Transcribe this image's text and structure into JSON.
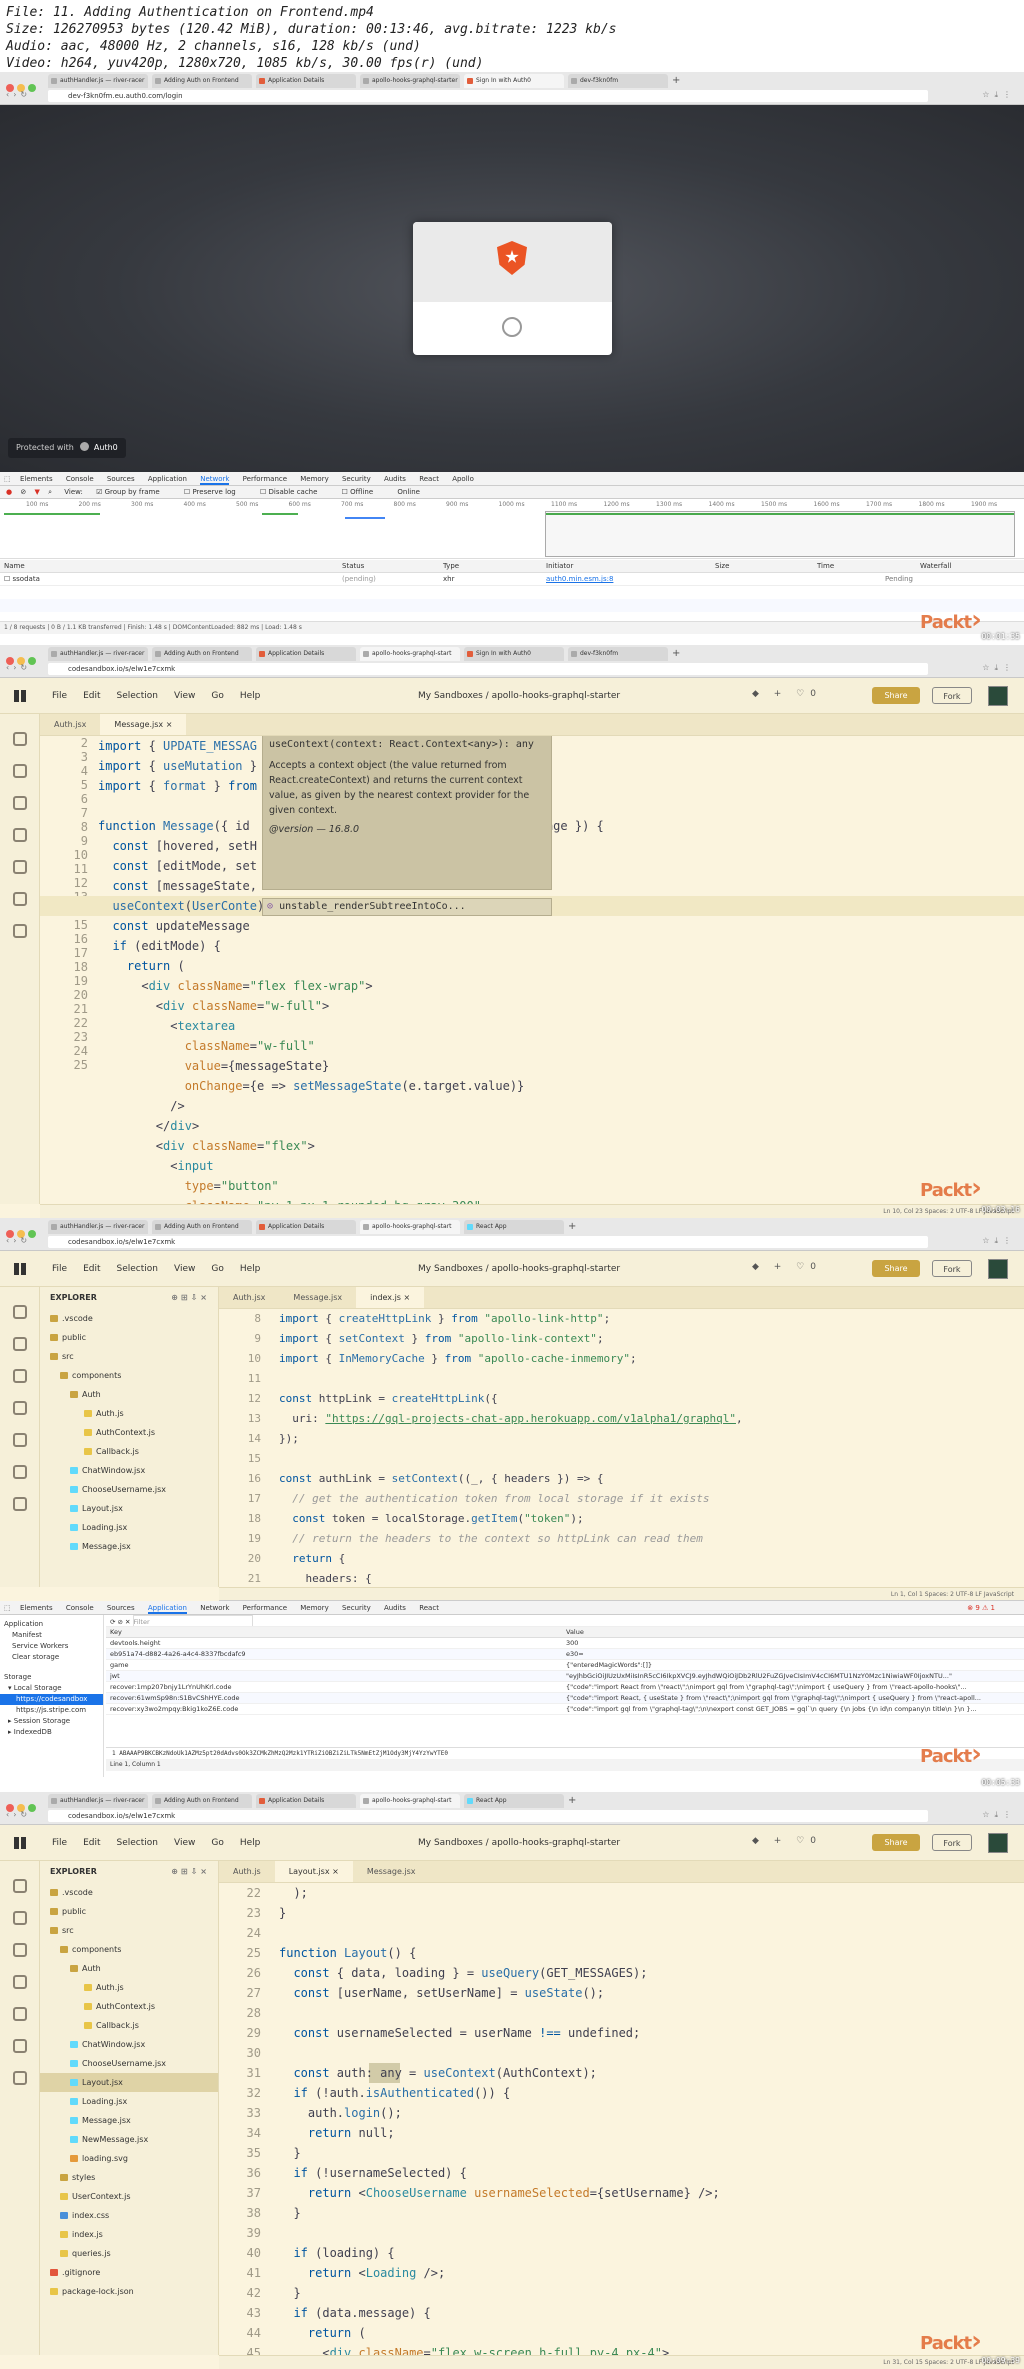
{
  "header": {
    "lines": [
      "File: 11. Adding Authentication on Frontend.mp4",
      "Size: 126270953 bytes (120.42 MiB), duration: 00:13:46, avg.bitrate: 1223 kb/s",
      "Audio: aac, 48000 Hz, 2 channels, s16, 128 kb/s (und)",
      "Video: h264, yuv420p, 1280x720, 1085 kb/s, 30.00 fps(r) (und)"
    ]
  },
  "frame1": {
    "tabs": [
      "authHandler.js — river-racer",
      "Adding Auth on Frontend",
      "Application Details",
      "apollo-hooks-graphql-starter",
      "Sign In with Auth0",
      "dev-f3kn0fm"
    ],
    "url": "dev-f3kn0fm.eu.auth0.com/login",
    "protected_text": "Protected with",
    "auth0_text": "Auth0",
    "devtools_tabs": [
      "Elements",
      "Console",
      "Sources",
      "Application",
      "Network",
      "Performance",
      "Memory",
      "Security",
      "Audits",
      "React",
      "Apollo"
    ],
    "filter_options": [
      "View:",
      "Group by frame",
      "Preserve log",
      "Disable cache",
      "Offline",
      "Online"
    ],
    "timeline_ticks": [
      "100 ms",
      "200 ms",
      "300 ms",
      "400 ms",
      "500 ms",
      "600 ms",
      "700 ms",
      "800 ms",
      "900 ms",
      "1000 ms",
      "1100 ms",
      "1200 ms",
      "1300 ms",
      "1400 ms",
      "1500 ms",
      "1600 ms",
      "1700 ms",
      "1800 ms",
      "1900 ms"
    ],
    "columns": [
      "Name",
      "Status",
      "Type",
      "Initiator",
      "Size",
      "Time",
      "Waterfall"
    ],
    "row": {
      "name": "ssodata",
      "status": "(pending)",
      "type": "xhr",
      "initiator": "auth0.min.esm.js:8",
      "size": "",
      "time": "Pending"
    },
    "summary": "1 / 8 requests | 0 B / 1.1 KB transferred | Finish: 1.48 s | DOMContentLoaded: 882 ms | Load: 1.48 s",
    "timestamp": "00:01:35"
  },
  "sandbox": {
    "menu": [
      "File",
      "Edit",
      "Selection",
      "View",
      "Go",
      "Help"
    ],
    "title": "My Sandboxes / apollo-hooks-graphql-starter",
    "share": "Share",
    "fork": "Fork",
    "likes": "0",
    "url": "codesandbox.io/s/elw1e7cxmk"
  },
  "frame2": {
    "tabs": [
      "authHandler.js — river-racer",
      "Adding Auth on Frontend",
      "Application Details",
      "apollo-hooks-graphql-start",
      "Sign In with Auth0",
      "dev-f3kn0fm"
    ],
    "editor_tabs": [
      "Auth.jsx",
      "Message.jsx"
    ],
    "tooltip_sig": "useContext(context: React.Context<any>): any",
    "tooltip_body": "Accepts a context object (the value returned from React.createContext) and returns the current context value, as given by the nearest context provider for the given context.",
    "tooltip_version": "@version — 16.8.0",
    "suggestion": "unstable_renderSubtreeIntoCo...",
    "status": "Ln 10, Col 23    Spaces: 2    UTF-8    LF    JavaScript",
    "timestamp": "00:03:16"
  },
  "frame3": {
    "tabs": [
      "authHandler.js — river-racer",
      "Adding Auth on Frontend",
      "Application Details",
      "apollo-hooks-graphql-start",
      "React App"
    ],
    "editor_tabs": [
      "Auth.jsx",
      "Message.jsx",
      "index.js"
    ],
    "explorer_title": "EXPLORER",
    "tree": [
      ".vscode",
      "public",
      "src",
      "components",
      "Auth",
      "Auth.js",
      "AuthContext.js",
      "Callback.js",
      "ChatWindow.jsx",
      "ChooseUsername.jsx",
      "Layout.jsx",
      "Loading.jsx",
      "Message.jsx"
    ],
    "devtools_tabs": [
      "Elements",
      "Console",
      "Sources",
      "Application",
      "Network",
      "Performance",
      "Memory",
      "Security",
      "Audits",
      "React"
    ],
    "app_side": [
      "Application",
      "Manifest",
      "Service Workers",
      "Clear storage",
      "Storage",
      "Local Storage",
      "https://codesandbox",
      "https://js.stripe.com",
      "Session Storage",
      "IndexedDB"
    ],
    "table_head": [
      "Key",
      "Value"
    ],
    "rows": [
      [
        "devtools.height",
        "300"
      ],
      [
        "eb951a74-d882-4a26-a4c4-8337fbcdafc9",
        "e30="
      ],
      [
        "game",
        "{\"enteredMagicWords\":[]}"
      ],
      [
        "jwt",
        "\"eyJhbGciOiJIUzUxMiIsInR5cCI6IkpXVCJ9.eyJhdWQiOiJDb2RlU2FuZGJveCIsImV4cCI6MTU1NzY0Mzc1NiwiaWF0IjoxNTU...\""
      ],
      [
        "recover:1mp207bnjy1LrYnUhKrl.code",
        "{\"code\":\"import React from \\\"react\\\";\\nimport gql from \\\"graphql-tag\\\";\\nimport { useQuery } from \\\"react-apollo-hooks\\\"..."
      ],
      [
        "recover:61wmSp98n:S1BvCShHYE.code",
        "{\"code\":\"import React, { useState } from \\\"react\\\";\\nimport gql from \\\"graphql-tag\\\";\\nimport { useQuery } from \\\"react-apoll..."
      ],
      [
        "recover:xy3wo2mpqy:Bkig1koZ6E.code",
        "{\"code\":\"import gql from \\\"graphql-tag\\\";\\n\\nexport const GET_JOBS = gql`\\n query {\\n jobs {\\n id\\n company\\n title\\n }\\n }..."
      ]
    ],
    "value_preview": "1  ABAAAP9BKCBKzNdoUk1AZMz5pt20dAdvs0Ok3ZCMkZhMzQ2Mzk1YTRiZiOBZiZiLTk5NmEtZjM1Ody3MjY4YzYwYTE0",
    "line_col": "Line 1, Column 1",
    "status": "Ln 1, Col 1    Spaces: 2    UTF-8    LF    JavaScript",
    "timestamp": "00:05:33"
  },
  "frame4": {
    "tabs": [
      "authHandler.js — river-racer",
      "Adding Auth on Frontend",
      "Application Details",
      "apollo-hooks-graphql-start",
      "React App"
    ],
    "editor_tabs": [
      "Auth.js",
      "Layout.jsx",
      "Message.jsx"
    ],
    "explorer_title": "EXPLORER",
    "tree": [
      ".vscode",
      "public",
      "src",
      "components",
      "Auth",
      "Auth.js",
      "AuthContext.js",
      "Callback.js",
      "ChatWindow.jsx",
      "ChooseUsername.jsx",
      "Layout.jsx",
      "Loading.jsx",
      "Message.jsx",
      "NewMessage.jsx",
      "loading.svg",
      "styles",
      "UserContext.js",
      "index.css",
      "index.js",
      "queries.js",
      ".gitignore",
      "package-lock.json"
    ],
    "status": "Ln 31, Col 15    Spaces: 2    UTF-8    LF    JavaScript",
    "timestamp": "00:09:39"
  },
  "packt": "Packt"
}
